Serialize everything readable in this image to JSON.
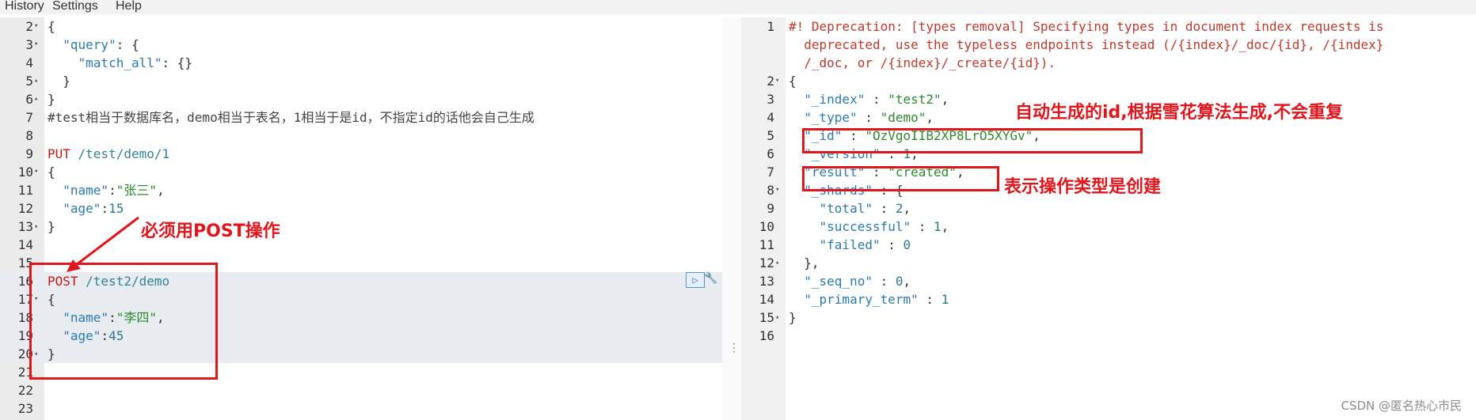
{
  "menu": {
    "history": "History",
    "settings": "Settings",
    "help": "Help"
  },
  "editor": {
    "lines": [
      {
        "n": "2",
        "fold": "▾",
        "parts": [
          [
            "",
            "{"
          ]
        ]
      },
      {
        "n": "3",
        "fold": "▾",
        "parts": [
          [
            "",
            "  "
          ],
          [
            "k",
            "\"query\""
          ],
          [
            "",
            ": {"
          ]
        ]
      },
      {
        "n": "4",
        "fold": "",
        "parts": [
          [
            "",
            "    "
          ],
          [
            "k",
            "\"match_all\""
          ],
          [
            "",
            ": {}"
          ]
        ]
      },
      {
        "n": "5",
        "fold": "▴",
        "parts": [
          [
            "",
            "  }"
          ]
        ]
      },
      {
        "n": "6",
        "fold": "▴",
        "parts": [
          [
            "",
            "}"
          ]
        ]
      },
      {
        "n": "7",
        "fold": "",
        "parts": [
          [
            "cm",
            "#test相当于数据库名，demo相当于表名，1相当于是id，不指定id的话他会自己生成"
          ]
        ]
      },
      {
        "n": "8",
        "fold": "",
        "parts": [
          [
            "",
            ""
          ]
        ]
      },
      {
        "n": "9",
        "fold": "",
        "parts": [
          [
            "mth",
            "PUT"
          ],
          [
            "url",
            " /test/demo/1"
          ]
        ]
      },
      {
        "n": "10",
        "fold": "▾",
        "parts": [
          [
            "",
            "{"
          ]
        ]
      },
      {
        "n": "11",
        "fold": "",
        "parts": [
          [
            "",
            "  "
          ],
          [
            "k",
            "\"name\""
          ],
          [
            "",
            ":"
          ],
          [
            "str",
            "\"张三\""
          ],
          [
            "",
            ","
          ]
        ]
      },
      {
        "n": "12",
        "fold": "",
        "parts": [
          [
            "",
            "  "
          ],
          [
            "k",
            "\"age\""
          ],
          [
            "",
            ":"
          ],
          [
            "n",
            "15"
          ]
        ]
      },
      {
        "n": "13",
        "fold": "▴",
        "parts": [
          [
            "",
            "}"
          ]
        ]
      },
      {
        "n": "14",
        "fold": "",
        "parts": [
          [
            "",
            ""
          ]
        ]
      },
      {
        "n": "15",
        "fold": "",
        "parts": [
          [
            "",
            ""
          ]
        ]
      },
      {
        "n": "16",
        "fold": "",
        "hl": true,
        "parts": [
          [
            "mth",
            "POST"
          ],
          [
            "url",
            " /test2/demo"
          ]
        ]
      },
      {
        "n": "17",
        "fold": "▾",
        "hl": true,
        "parts": [
          [
            "",
            "{"
          ]
        ]
      },
      {
        "n": "18",
        "fold": "",
        "hl": true,
        "parts": [
          [
            "",
            "  "
          ],
          [
            "k",
            "\"name\""
          ],
          [
            "",
            ":"
          ],
          [
            "str",
            "\"李四\""
          ],
          [
            "",
            ","
          ]
        ]
      },
      {
        "n": "19",
        "fold": "",
        "hl": true,
        "parts": [
          [
            "",
            "  "
          ],
          [
            "k",
            "\"age\""
          ],
          [
            "",
            ":"
          ],
          [
            "n",
            "45"
          ]
        ]
      },
      {
        "n": "20",
        "fold": "▴",
        "hl": true,
        "parts": [
          [
            "",
            "}"
          ]
        ]
      },
      {
        "n": "21",
        "fold": "",
        "parts": [
          [
            "",
            ""
          ]
        ]
      },
      {
        "n": "22",
        "fold": "",
        "parts": [
          [
            "",
            ""
          ]
        ]
      },
      {
        "n": "23",
        "fold": "",
        "parts": [
          [
            "",
            ""
          ]
        ]
      }
    ]
  },
  "output": {
    "lines": [
      {
        "n": "1",
        "fold": "",
        "parts": [
          [
            "warn",
            "#! Deprecation: [types removal] Specifying types in document index requests is"
          ]
        ]
      },
      {
        "n": "",
        "fold": "",
        "parts": [
          [
            "warn",
            "  deprecated, use the typeless endpoints instead (/{index}/_doc/{id}, /{index}"
          ]
        ]
      },
      {
        "n": "",
        "fold": "",
        "parts": [
          [
            "warn",
            "  /_doc, or /{index}/_create/{id})."
          ]
        ]
      },
      {
        "n": "2",
        "fold": "▾",
        "parts": [
          [
            "",
            "{"
          ]
        ]
      },
      {
        "n": "3",
        "fold": "",
        "parts": [
          [
            "",
            "  "
          ],
          [
            "k",
            "\"_index\""
          ],
          [
            "",
            " : "
          ],
          [
            "str",
            "\"test2\""
          ],
          [
            "",
            ","
          ]
        ]
      },
      {
        "n": "4",
        "fold": "",
        "parts": [
          [
            "",
            "  "
          ],
          [
            "k",
            "\"_type\""
          ],
          [
            "",
            " : "
          ],
          [
            "str",
            "\"demo\""
          ],
          [
            "",
            ","
          ]
        ]
      },
      {
        "n": "5",
        "fold": "",
        "parts": [
          [
            "",
            "  "
          ],
          [
            "k",
            "\"_id\""
          ],
          [
            "",
            " : "
          ],
          [
            "str",
            "\"OzVgoIIB2XP8LrO5XYGv\""
          ],
          [
            "",
            ","
          ]
        ]
      },
      {
        "n": "6",
        "fold": "",
        "parts": [
          [
            "",
            "  "
          ],
          [
            "k",
            "\"_version\""
          ],
          [
            "",
            " : "
          ],
          [
            "n",
            "1"
          ],
          [
            "",
            ","
          ]
        ]
      },
      {
        "n": "7",
        "fold": "",
        "parts": [
          [
            "",
            "  "
          ],
          [
            "k",
            "\"result\""
          ],
          [
            "",
            " : "
          ],
          [
            "str",
            "\"created\""
          ],
          [
            "",
            ","
          ]
        ]
      },
      {
        "n": "8",
        "fold": "▾",
        "parts": [
          [
            "",
            "  "
          ],
          [
            "k",
            "\"_shards\""
          ],
          [
            "",
            " : {"
          ]
        ]
      },
      {
        "n": "9",
        "fold": "",
        "parts": [
          [
            "",
            "    "
          ],
          [
            "k",
            "\"total\""
          ],
          [
            "",
            " : "
          ],
          [
            "n",
            "2"
          ],
          [
            "",
            ","
          ]
        ]
      },
      {
        "n": "10",
        "fold": "",
        "parts": [
          [
            "",
            "    "
          ],
          [
            "k",
            "\"successful\""
          ],
          [
            "",
            " : "
          ],
          [
            "n",
            "1"
          ],
          [
            "",
            ","
          ]
        ]
      },
      {
        "n": "11",
        "fold": "",
        "parts": [
          [
            "",
            "    "
          ],
          [
            "k",
            "\"failed\""
          ],
          [
            "",
            " : "
          ],
          [
            "n",
            "0"
          ]
        ]
      },
      {
        "n": "12",
        "fold": "▴",
        "parts": [
          [
            "",
            "  },"
          ]
        ]
      },
      {
        "n": "13",
        "fold": "",
        "parts": [
          [
            "",
            "  "
          ],
          [
            "k",
            "\"_seq_no\""
          ],
          [
            "",
            " : "
          ],
          [
            "n",
            "0"
          ],
          [
            "",
            ","
          ]
        ]
      },
      {
        "n": "14",
        "fold": "",
        "parts": [
          [
            "",
            "  "
          ],
          [
            "k",
            "\"_primary_term\""
          ],
          [
            "",
            " : "
          ],
          [
            "n",
            "1"
          ]
        ]
      },
      {
        "n": "15",
        "fold": "▴",
        "parts": [
          [
            "",
            "}"
          ]
        ]
      },
      {
        "n": "16",
        "fold": "",
        "parts": [
          [
            "",
            ""
          ]
        ]
      }
    ]
  },
  "annotations": {
    "post_note": "必须用POST操作",
    "id_note": "自动生成的id,根据雪花算法生成,不会重复",
    "result_note": "表示操作类型是创建"
  },
  "watermark": "CSDN @匿名热心市民",
  "colors": {
    "annotation": "#e0161d",
    "keyword": "#2a7ab0",
    "string": "#2d8a2d",
    "method": "#c41a16",
    "warning": "#c0392b"
  }
}
